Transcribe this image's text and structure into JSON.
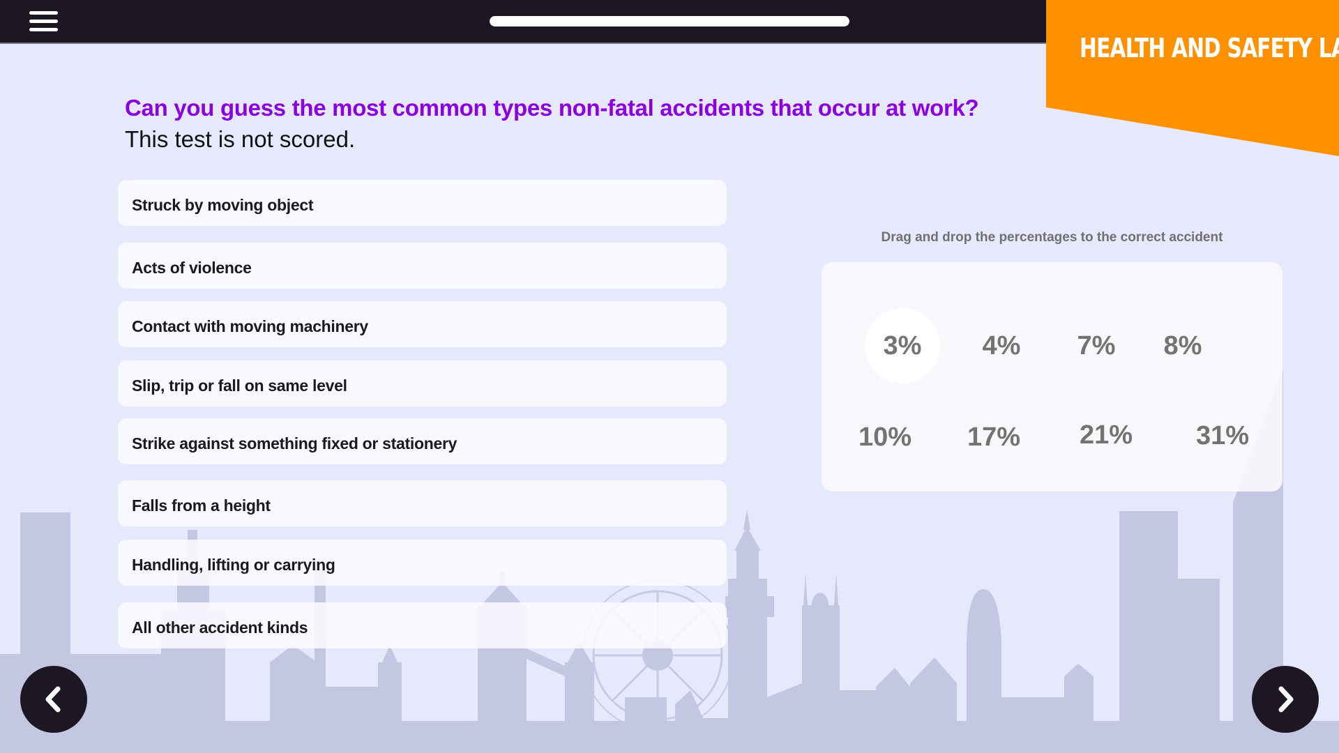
{
  "header": {
    "menu_icon": "hamburger-menu-icon",
    "progress_percent": 100,
    "course_title": "HEALTH AND SAFETY LAW"
  },
  "question": {
    "title": "Can you guess the most common types non-fatal accidents that occur at work?",
    "subtitle": "This test is not scored."
  },
  "accidents": [
    {
      "label": "Struck by moving object"
    },
    {
      "label": "Acts of violence"
    },
    {
      "label": "Contact with moving machinery"
    },
    {
      "label": "Slip, trip or fall on same level"
    },
    {
      "label": "Strike against something fixed or stationery"
    },
    {
      "label": "Falls from a height"
    },
    {
      "label": "Handling, lifting or carrying"
    },
    {
      "label": "All other accident kinds"
    }
  ],
  "percentages": {
    "hint": "Drag and drop the percentages to the correct accident",
    "options": [
      {
        "label": "3%",
        "selected": true
      },
      {
        "label": "4%",
        "selected": false
      },
      {
        "label": "7%",
        "selected": false
      },
      {
        "label": "8%",
        "selected": false
      },
      {
        "label": "10%",
        "selected": false
      },
      {
        "label": "17%",
        "selected": false
      },
      {
        "label": "21%",
        "selected": false
      },
      {
        "label": "31%",
        "selected": false
      }
    ]
  },
  "navigation": {
    "previous_icon": "chevron-left-icon",
    "next_icon": "chevron-right-icon"
  },
  "colors": {
    "topbar": "#1c1722",
    "accent_orange": "#ff9100",
    "question_purple": "#8a00e0",
    "background": "#e6e8fc",
    "skyline": "#c4c7e2"
  }
}
